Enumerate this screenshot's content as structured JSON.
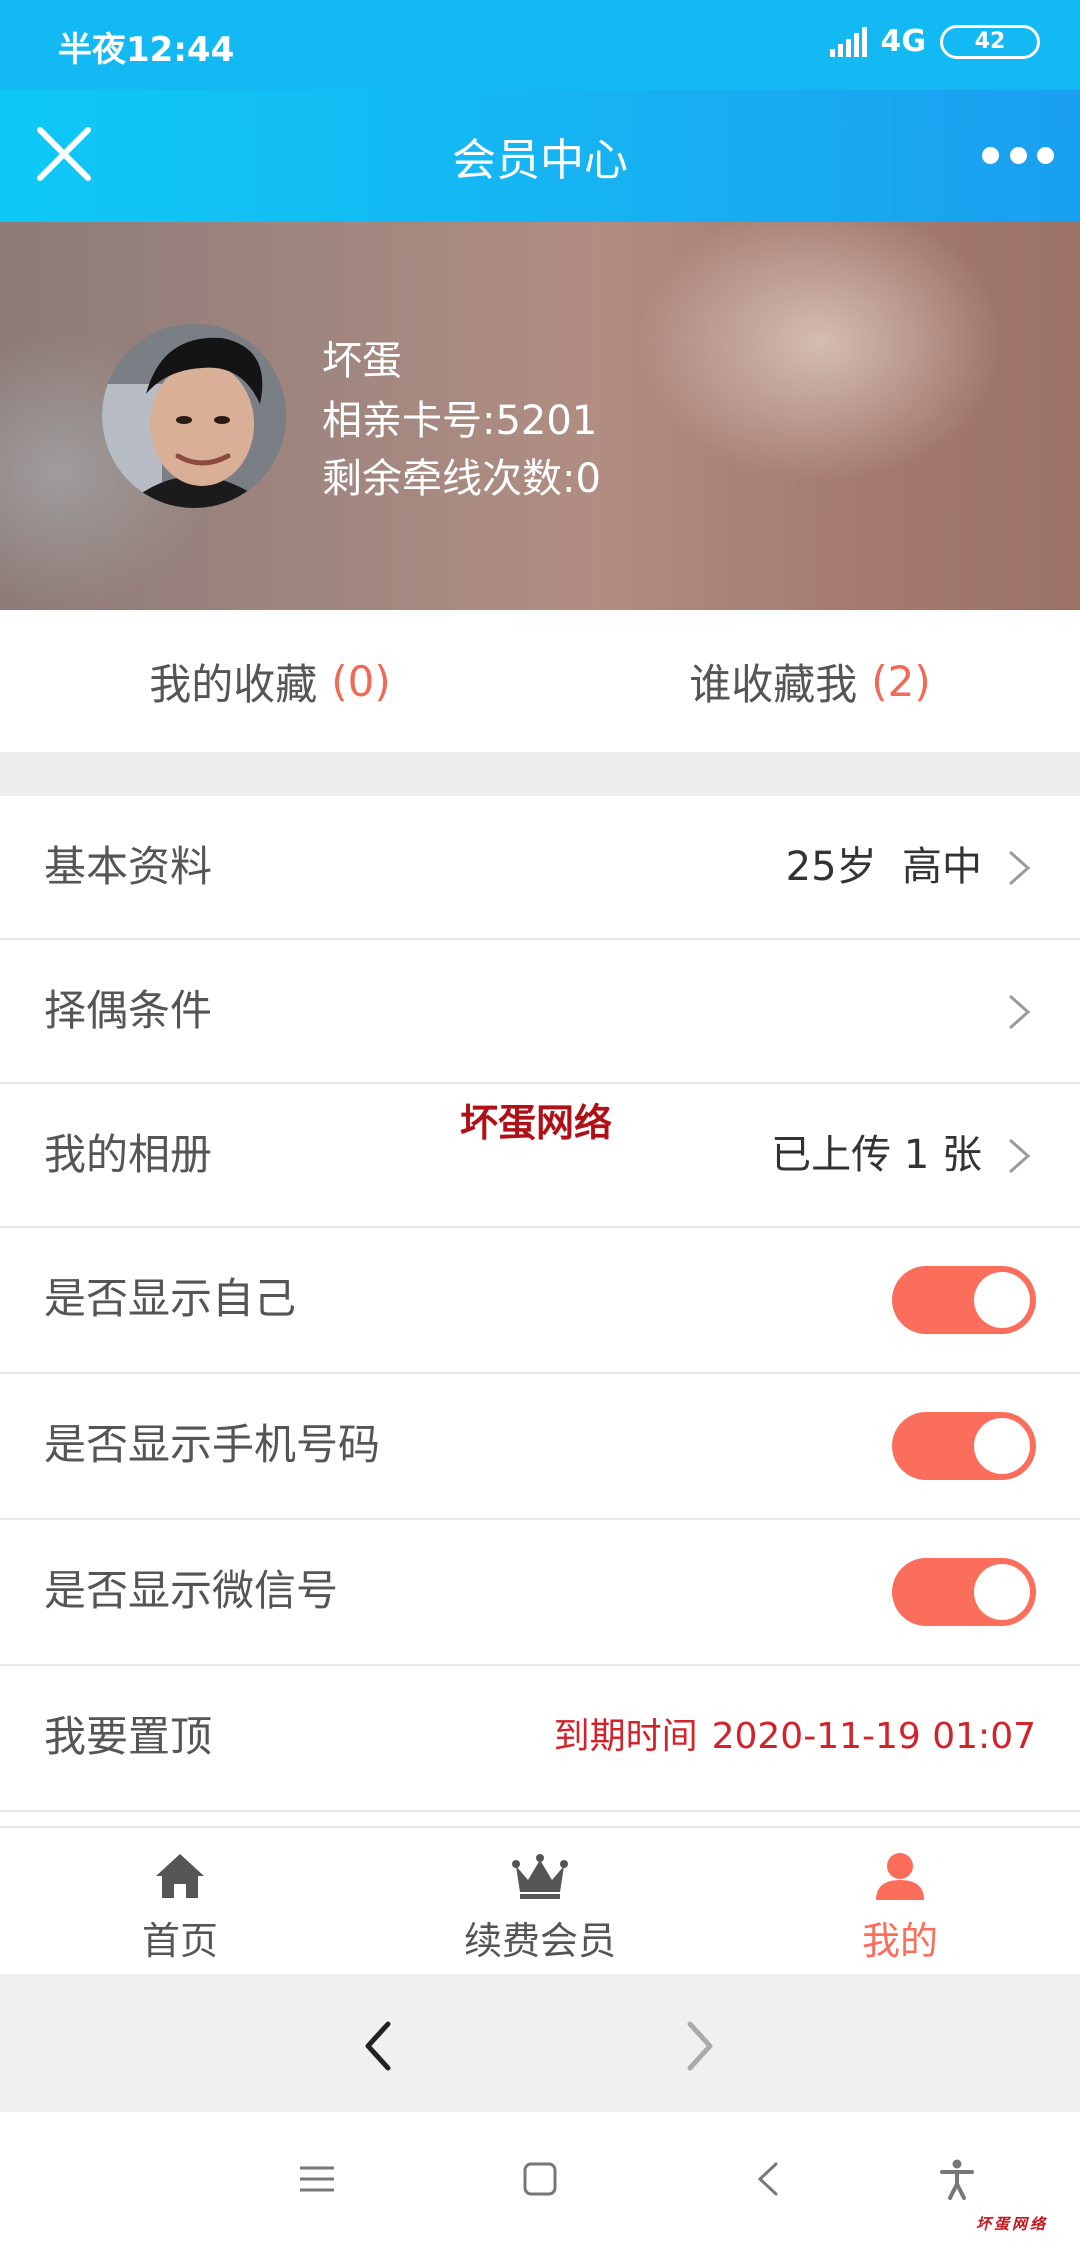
{
  "status": {
    "time": "半夜12:44",
    "network": "4G",
    "battery": "42"
  },
  "header": {
    "title": "会员中心",
    "close_icon": "close-icon",
    "more_icon": "more-dots-icon"
  },
  "profile": {
    "name": "坏蛋",
    "card_number": "相亲卡号:5201",
    "remaining": "剩余牵线次数:0"
  },
  "favorites": {
    "mine_label": "我的收藏",
    "mine_count": "(0)",
    "who_label": "谁收藏我",
    "who_count": "(2)"
  },
  "rows": {
    "basic_info": {
      "label": "基本资料",
      "value": "25岁  高中"
    },
    "partner_conditions": {
      "label": "择偶条件"
    },
    "album": {
      "label": "我的相册",
      "value": "已上传 1 张"
    },
    "show_self": {
      "label": "是否显示自己",
      "on": true
    },
    "show_phone": {
      "label": "是否显示手机号码",
      "on": true
    },
    "show_wechat": {
      "label": "是否显示微信号",
      "on": true
    },
    "pin_top": {
      "label": "我要置顶",
      "expire_label": "到期时间",
      "expire_value": "2020-11-19 01:07"
    }
  },
  "watermark": "坏蛋网络",
  "bottom_nav": [
    {
      "label": "首页",
      "icon": "home-icon"
    },
    {
      "label": "续费会员",
      "icon": "crown-icon"
    },
    {
      "label": "我的",
      "icon": "user-icon",
      "active": true
    }
  ],
  "brand_mark": "坏蛋网络",
  "colors": {
    "header": "#12b9f3",
    "accent": "#fb6e5b",
    "expire": "#d2222a"
  }
}
